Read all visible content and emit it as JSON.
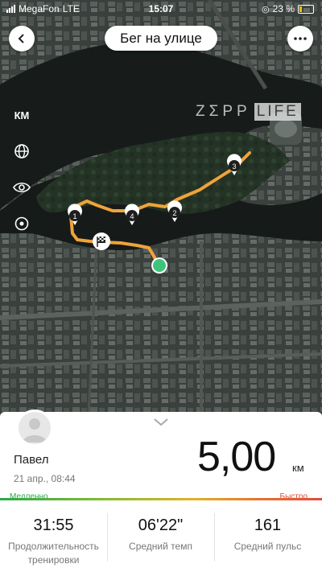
{
  "status_bar": {
    "carrier": "MegaFon",
    "network": "LTE",
    "time": "15:07",
    "battery": "23 %"
  },
  "header": {
    "back_icon": "chevron-left-icon",
    "title": "Бег на улице",
    "more_icon": "more-dots-icon"
  },
  "map_controls": {
    "units": "КМ",
    "globe_icon": "globe-icon",
    "eye_icon": "eye-icon",
    "locate_icon": "target-icon"
  },
  "logo": {
    "part1": "ZΣPP",
    "part2": "LIFE"
  },
  "route": {
    "color": "#f0a33a",
    "markers": [
      "1",
      "2",
      "3",
      "4"
    ],
    "end_color": "#3ec47a"
  },
  "summary": {
    "user_name": "Павел",
    "date": "21 апр., 08:44",
    "distance": "5,00",
    "unit": "км",
    "pace_slow": "Медленно",
    "pace_fast": "Быстро"
  },
  "stats": [
    {
      "value": "31:55",
      "label": "Продолжительность тренировки"
    },
    {
      "value": "06'22\"",
      "label": "Средний темп"
    },
    {
      "value": "161",
      "label": "Средний пульс"
    }
  ]
}
